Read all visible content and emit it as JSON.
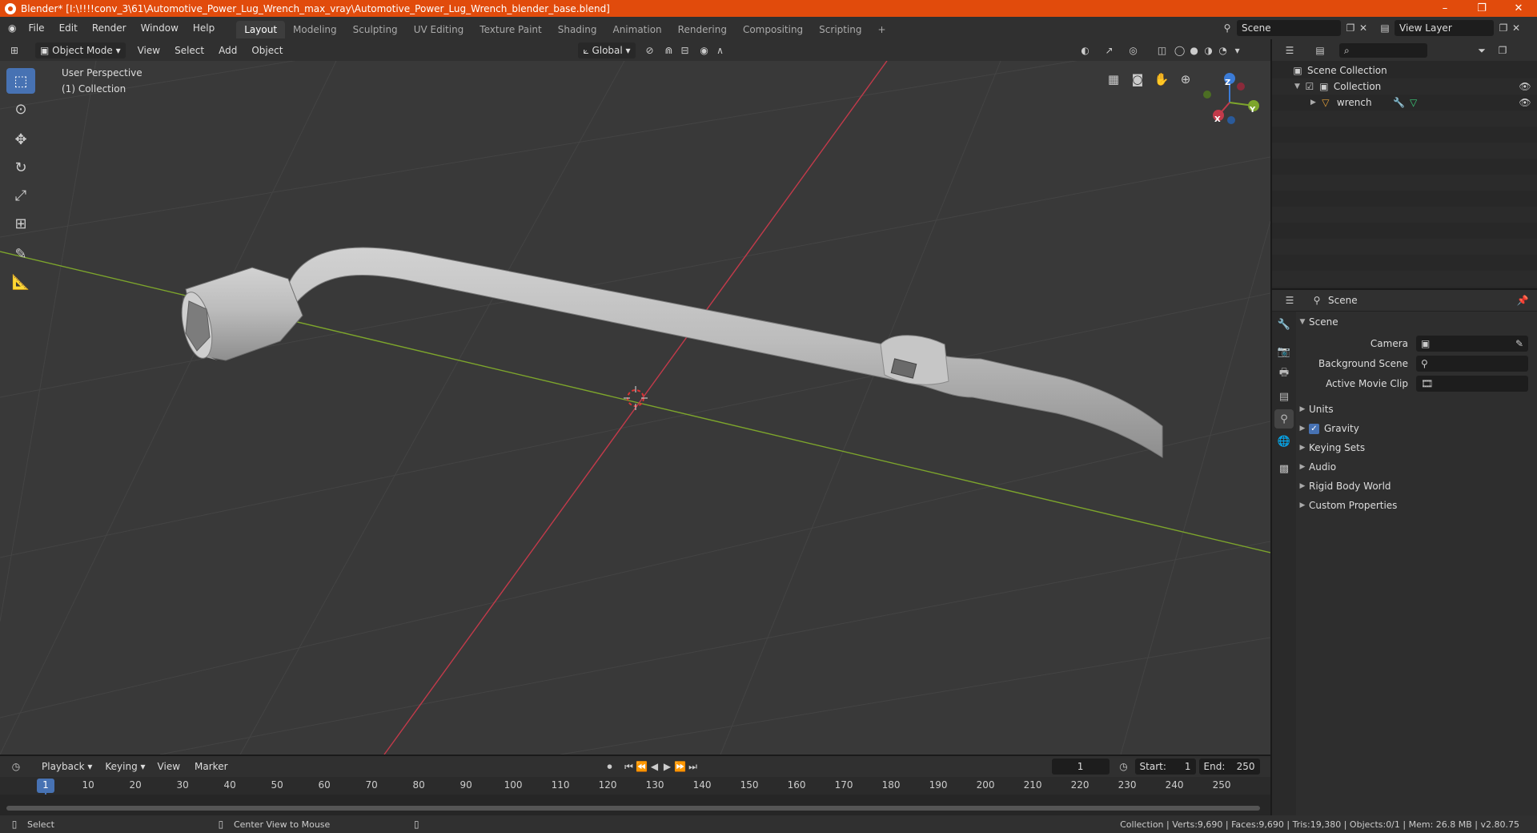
{
  "window": {
    "title": "Blender* [I:\\!!!!conv_3\\61\\Automotive_Power_Lug_Wrench_max_vray\\Automotive_Power_Lug_Wrench_blender_base.blend]",
    "minimize": "–",
    "maximize": "❐",
    "close": "✕"
  },
  "menu": [
    "File",
    "Edit",
    "Render",
    "Window",
    "Help"
  ],
  "workspaces": [
    "Layout",
    "Modeling",
    "Sculpting",
    "UV Editing",
    "Texture Paint",
    "Shading",
    "Animation",
    "Rendering",
    "Compositing",
    "Scripting"
  ],
  "workspace_add": "+",
  "scene_selector": "Scene",
  "view_layer": "View Layer",
  "viewport_header": {
    "mode": "Object Mode",
    "menus": [
      "View",
      "Select",
      "Add",
      "Object"
    ],
    "transform_orientation": "Global"
  },
  "viewport": {
    "perspective_label": "User Perspective",
    "collection_label": "(1) Collection",
    "gizmo": {
      "x": "X",
      "y": "Y",
      "z": "Z"
    }
  },
  "outliner": {
    "root": "Scene Collection",
    "collection": "Collection",
    "object": "wrench"
  },
  "properties": {
    "context": "Scene",
    "panel_scene": "Scene",
    "camera_label": "Camera",
    "background_scene_label": "Background Scene",
    "active_movie_clip_label": "Active Movie Clip",
    "panels": [
      "Units",
      "Gravity",
      "Keying Sets",
      "Audio",
      "Rigid Body World",
      "Custom Properties"
    ]
  },
  "timeline": {
    "menus": [
      "Playback",
      "Keying",
      "View",
      "Marker"
    ],
    "current_frame": "1",
    "start_label": "Start:",
    "start_value": "1",
    "end_label": "End:",
    "end_value": "250",
    "ticks": [
      "1",
      "10",
      "20",
      "30",
      "40",
      "50",
      "60",
      "70",
      "80",
      "90",
      "100",
      "110",
      "120",
      "130",
      "140",
      "150",
      "160",
      "170",
      "180",
      "190",
      "200",
      "210",
      "220",
      "230",
      "240",
      "250"
    ]
  },
  "status": {
    "select": "Select",
    "center_view": "Center View to Mouse",
    "stats": "Collection | Verts:9,690 | Faces:9,690 | Tris:19,380 | Objects:0/1 | Mem: 26.8 MB | v2.80.75"
  },
  "colors": {
    "title_bar": "#e14b0c",
    "accent": "#4772b3",
    "x_axis": "#c23a4a",
    "y_axis": "#7da52c",
    "z_axis": "#3b7bd6"
  }
}
